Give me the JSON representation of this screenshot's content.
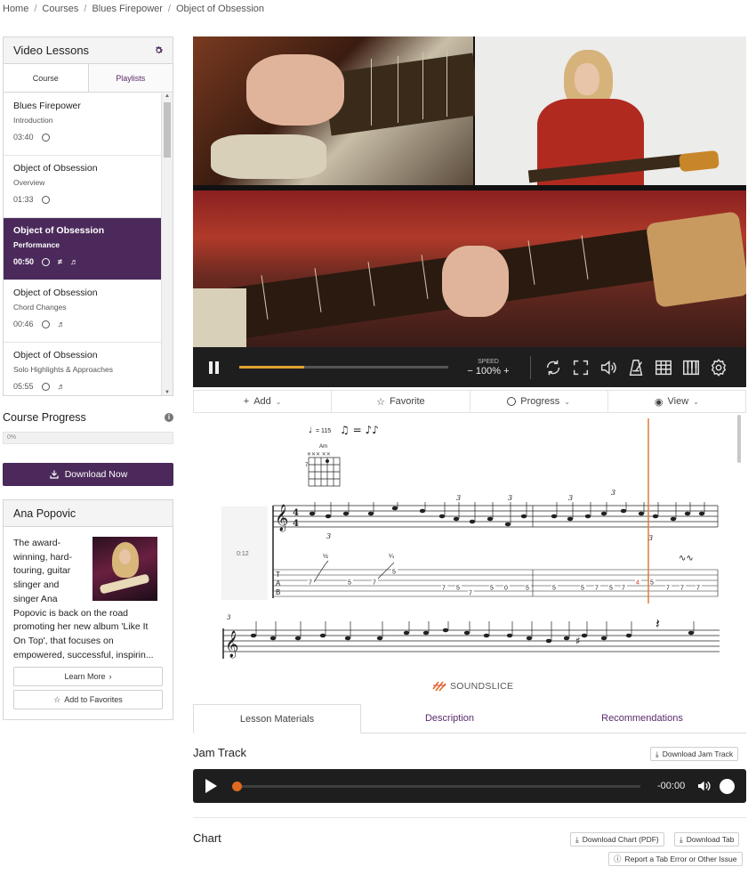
{
  "breadcrumb": [
    "Home",
    "Courses",
    "Blues Firepower",
    "Object of Obsession"
  ],
  "sidebar": {
    "title": "Video Lessons",
    "tabs": [
      "Course",
      "Playlists"
    ],
    "lessons": [
      {
        "title": "Blues Firepower",
        "subtitle": "Introduction",
        "time": "03:40",
        "active": false
      },
      {
        "title": "Object of Obsession",
        "subtitle": "Overview",
        "time": "01:33",
        "active": false
      },
      {
        "title": "Object of Obsession",
        "subtitle": "Performance",
        "time": "00:50",
        "active": true
      },
      {
        "title": "Object of Obsession",
        "subtitle": "Chord Changes",
        "time": "00:46",
        "active": false
      },
      {
        "title": "Object of Obsession",
        "subtitle": "Solo Highlights & Approaches",
        "time": "05:55",
        "active": false
      }
    ]
  },
  "course_progress": {
    "label": "Course Progress",
    "value": "0%",
    "fraction": 0.0
  },
  "download_now": "Download Now",
  "artist": {
    "name": "Ana Popovic",
    "bio": "The award-winning, hard-touring, guitar slinger and singer Ana Popovic is back on the road promoting her new album 'Like It On Top', that focuses on empowered, successful, inspirin...",
    "learn_more": "Learn More",
    "add_favorites": "Add to Favorites"
  },
  "player": {
    "speed_label": "SPEED",
    "speed_value": "100%",
    "speed_minus": "−",
    "speed_plus": "+",
    "progress_fraction": 0.31,
    "icons": [
      "loop-icon",
      "fullscreen-icon",
      "volume-icon",
      "metronome-icon",
      "fretboard-icon",
      "piano-icon",
      "settings-icon"
    ]
  },
  "toolbar": {
    "add": "Add",
    "favorite": "Favorite",
    "progress": "Progress",
    "view": "View"
  },
  "notation": {
    "tempo": "= 115",
    "chord": "Am",
    "chord_fret": "7",
    "timestamp": "0:12",
    "triplet": "3",
    "bend_quarter": "¼",
    "bend_half": "½",
    "tab_letters": [
      "T",
      "A",
      "B"
    ],
    "tab_numbers": [
      "7",
      "5",
      "7",
      "5",
      "7",
      "5",
      "7",
      "5",
      "0",
      "5",
      "5",
      "5",
      "7",
      "5",
      "7",
      "4",
      "5",
      "7",
      "7",
      "7"
    ]
  },
  "soundslice": "SOUNDSLICE",
  "tabs": [
    "Lesson Materials",
    "Description",
    "Recommendations"
  ],
  "jam_track": {
    "title": "Jam Track",
    "download": "Download Jam Track",
    "time": "-00:00"
  },
  "chart": {
    "title": "Chart",
    "download_pdf": "Download Chart (PDF)",
    "download_tab": "Download Tab",
    "report": "Report a Tab Error or Other Issue"
  },
  "colors": {
    "accent": "#4b2a5b",
    "player_bg": "#1e1e1e",
    "seek": "#e0a030",
    "audio_knob": "#e06a20",
    "playhead": "#e07a40"
  }
}
